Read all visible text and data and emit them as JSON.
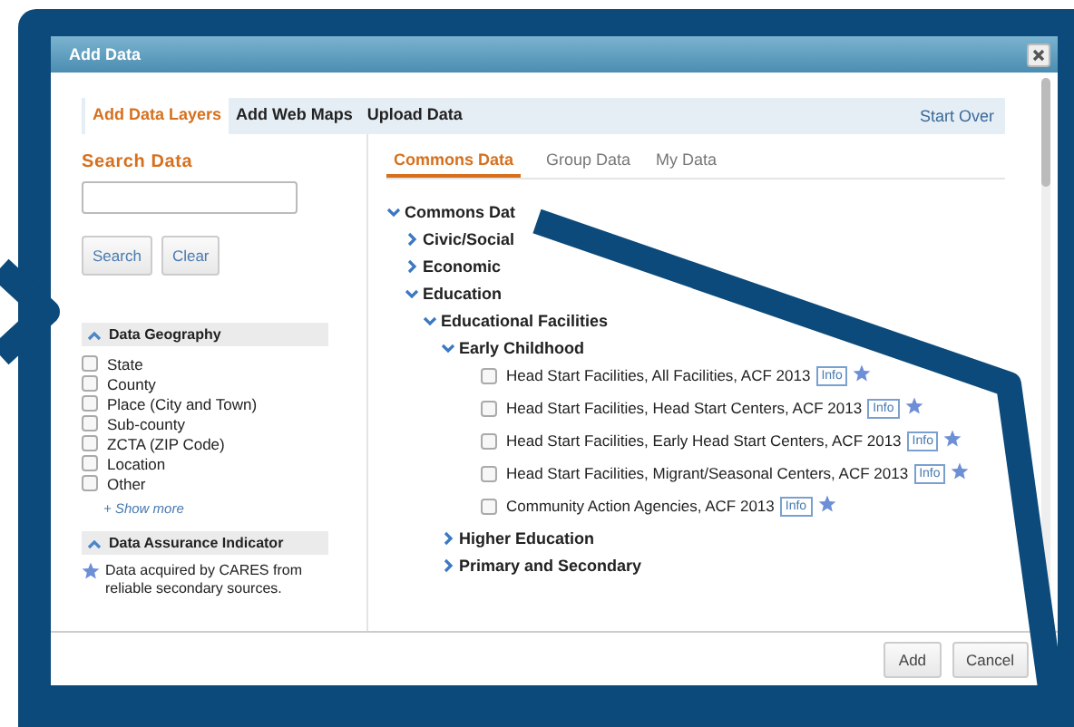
{
  "window": {
    "title": "Add Data"
  },
  "tabs": [
    {
      "label": "Add Data Layers",
      "selected": true
    },
    {
      "label": "Add Web Maps",
      "selected": false
    },
    {
      "label": "Upload Data",
      "selected": false
    }
  ],
  "start_over": "Start Over",
  "search": {
    "title": "Search Data",
    "buttons": [
      "Search",
      "Clear"
    ]
  },
  "filters": [
    {
      "title": "Data Geography",
      "expanded": true,
      "items": [
        {
          "label": "State",
          "checked": false
        },
        {
          "label": "County",
          "checked": false
        },
        {
          "label": "Place (City and Town)",
          "checked": false
        },
        {
          "label": "Sub-county",
          "checked": false
        },
        {
          "label": "ZCTA (ZIP Code)",
          "checked": false
        },
        {
          "label": "Location",
          "checked": false
        },
        {
          "label": "Other",
          "checked": false
        }
      ],
      "more": "+ Show more"
    },
    {
      "title": "Data Assurance Indicator",
      "expanded": true,
      "note": "Data acquired by CARES from reliable secondary sources."
    }
  ],
  "subtabs": [
    {
      "label": "Commons Data",
      "selected": true
    },
    {
      "label": "Group Data",
      "selected": false
    },
    {
      "label": "My Data",
      "selected": false
    }
  ],
  "tree": [
    {
      "kind": "folder",
      "label": "Commons Dat",
      "expanded": true,
      "children": [
        {
          "kind": "folder",
          "label": "Civic/Social",
          "expanded": false
        },
        {
          "kind": "folder",
          "label": "Economic",
          "expanded": false
        },
        {
          "kind": "folder",
          "label": "Education",
          "expanded": true,
          "children": [
            {
              "kind": "folder",
              "label": "Educational Facilities",
              "expanded": true,
              "children": [
                {
                  "kind": "folder",
                  "label": "Early Childhood",
                  "expanded": true,
                  "children": [
                    {
                      "kind": "layer",
                      "label": "Head Start Facilities, All Facilities, ACF 2013",
                      "checked": false,
                      "info": "Info",
                      "starred": true
                    },
                    {
                      "kind": "layer",
                      "label": "Head Start Facilities, Head Start Centers, ACF 2013",
                      "checked": false,
                      "info": "Info",
                      "starred": true
                    },
                    {
                      "kind": "layer",
                      "label": "Head Start Facilities, Early Head Start Centers, ACF 2013",
                      "checked": false,
                      "info": "Info",
                      "starred": true
                    },
                    {
                      "kind": "layer",
                      "label": "Head Start Facilities, Migrant/Seasonal Centers, ACF 2013",
                      "checked": false,
                      "info": "Info",
                      "starred": true
                    },
                    {
                      "kind": "layer",
                      "label": "Community Action Agencies, ACF 2013",
                      "checked": false,
                      "info": "Info",
                      "starred": true
                    }
                  ]
                },
                {
                  "kind": "folder",
                  "label": "Higher Education",
                  "expanded": false
                },
                {
                  "kind": "folder",
                  "label": "Primary and Secondary",
                  "expanded": false
                }
              ]
            }
          ]
        }
      ]
    }
  ],
  "footer_buttons": [
    "Add",
    "Cancel"
  ]
}
